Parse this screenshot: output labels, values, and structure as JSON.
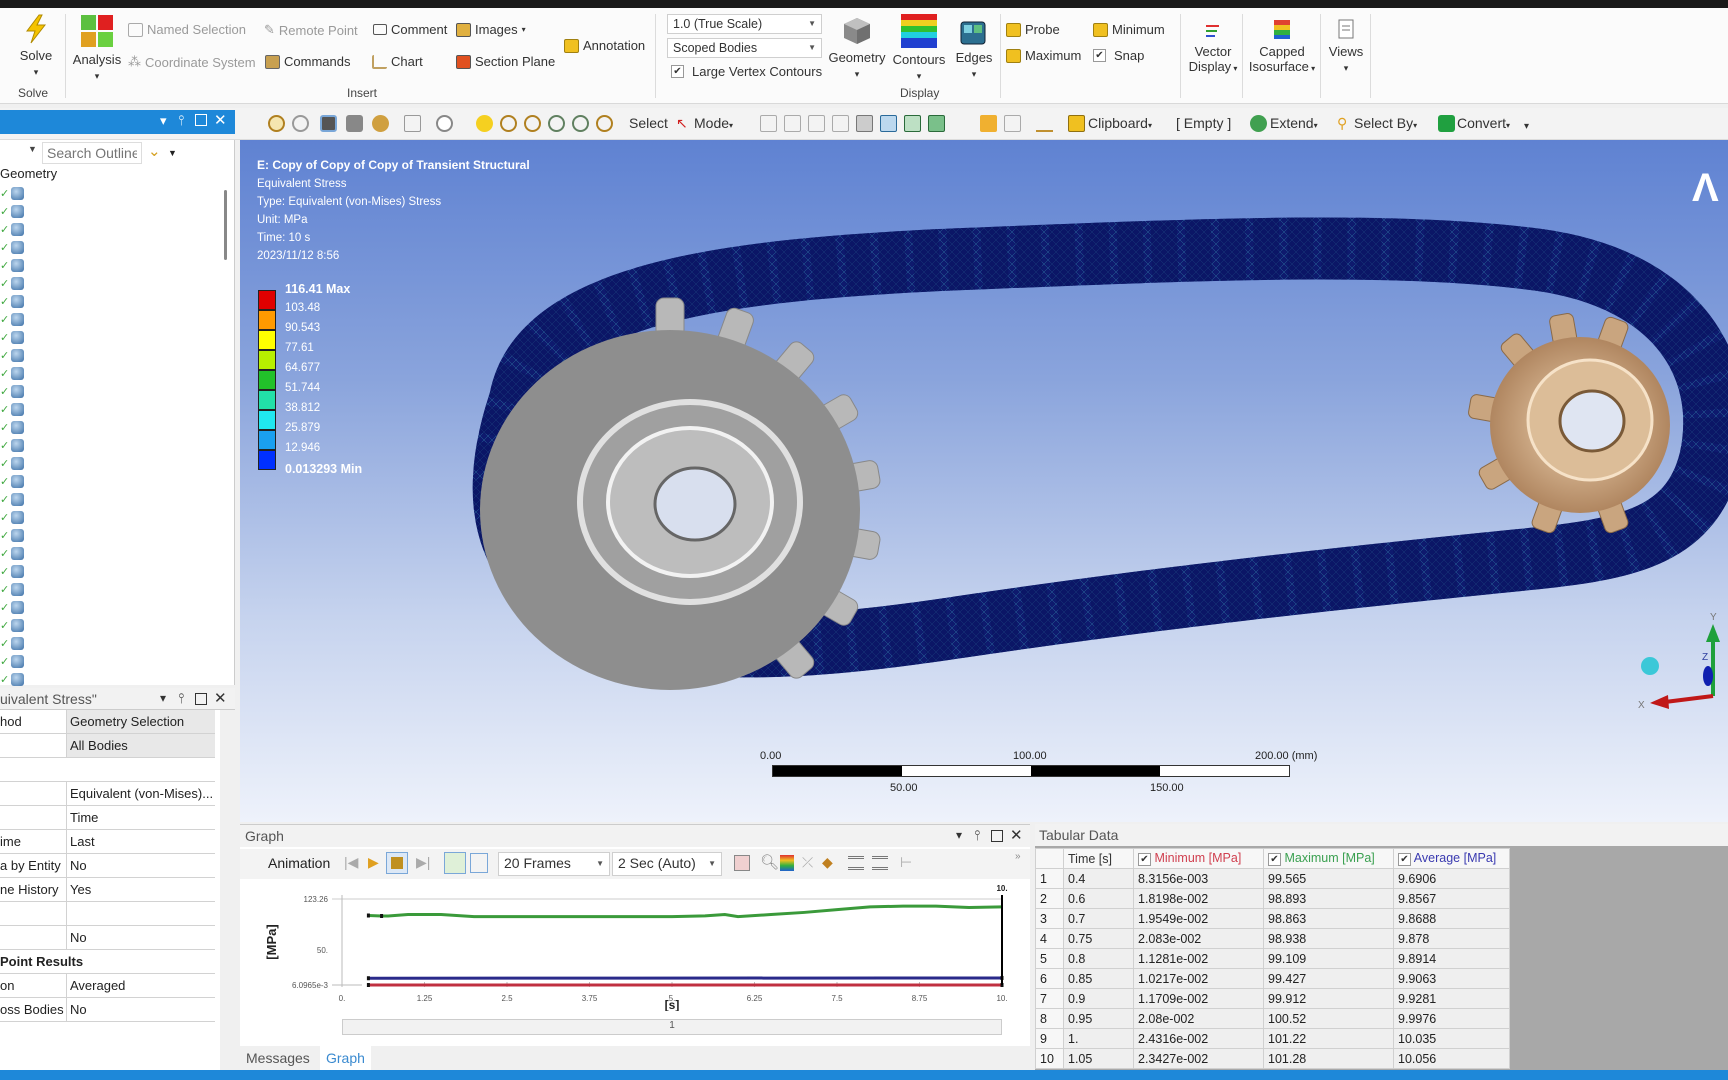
{
  "ribbon": {
    "solve": {
      "label": "Solve",
      "group": "Solve"
    },
    "analysis": {
      "label": "Analysis"
    },
    "insert": {
      "group": "Insert",
      "named_selection": "Named Selection",
      "remote_point": "Remote Point",
      "comment": "Comment",
      "images": "Images",
      "coordinate_system": "Coordinate System",
      "commands": "Commands",
      "chart": "Chart",
      "section_plane": "Section Plane",
      "annotation": "Annotation"
    },
    "display": {
      "group": "Display",
      "scale_value": "1.0 (True Scale)",
      "scope_value": "Scoped Bodies",
      "large_vertex_label": "Large Vertex Contours",
      "large_vertex_checked": true,
      "geometry": "Geometry",
      "contours": "Contours",
      "edges": "Edges",
      "probe": "Probe",
      "minimum": "Minimum",
      "maximum": "Maximum",
      "snap": "Snap",
      "snap_checked": true,
      "vector_display": "Vector Display",
      "capped_isosurface": "Capped Isosurface",
      "views": "Views"
    }
  },
  "toolbar": {
    "select": "Select",
    "mode": "Mode",
    "clipboard": "Clipboard",
    "clipboard_state": "[ Empty ]",
    "extend": "Extend",
    "select_by": "Select By",
    "convert": "Convert"
  },
  "outline": {
    "search_placeholder": "Search Outline",
    "root": "Geometry",
    "body_count": 28
  },
  "details": {
    "title": "uivalent Stress\"",
    "rows": [
      {
        "key": "hod",
        "value": "Geometry Selection",
        "shade": true
      },
      {
        "key": "",
        "value": "All Bodies",
        "shade": true
      },
      {
        "key": "",
        "value": "",
        "blank": true
      },
      {
        "key": "",
        "value": "Equivalent (von-Mises)..."
      },
      {
        "key": "",
        "value": "Time"
      },
      {
        "key": "ime",
        "value": "Last"
      },
      {
        "key": "a by Entity",
        "value": "No"
      },
      {
        "key": "ne History",
        "value": "Yes"
      },
      {
        "key": "",
        "value": ""
      },
      {
        "key": "",
        "value": "No"
      },
      {
        "section": "Point Results"
      },
      {
        "key": "on",
        "value": "Averaged"
      },
      {
        "key": "oss Bodies",
        "value": "No"
      }
    ]
  },
  "viewport": {
    "title": "E: Copy of Copy of Copy of Transient Structural",
    "result_name": "Equivalent Stress",
    "type": "Type: Equivalent (von-Mises) Stress",
    "unit": "Unit: MPa",
    "time": "Time: 10 s",
    "date": "2023/11/12 8:56",
    "legend": {
      "values": [
        "116.41 Max",
        "103.48",
        "90.543",
        "77.61",
        "64.677",
        "51.744",
        "38.812",
        "25.879",
        "12.946",
        "0.013293 Min"
      ],
      "colors": [
        "#e00000",
        "#ff9a00",
        "#ffff00",
        "#b8f000",
        "#22c22a",
        "#22e0a8",
        "#20e8f0",
        "#1aa0f0",
        "#0030ff"
      ]
    },
    "scale_bar": {
      "labels_top": [
        "0.00",
        "100.00",
        "200.00 (mm)"
      ],
      "labels_bottom": [
        "50.00",
        "150.00"
      ]
    },
    "triad": {
      "x": "X",
      "y": "Y",
      "z": "Z"
    }
  },
  "graph": {
    "title": "Graph",
    "animation_label": "Animation",
    "frames": "20 Frames",
    "duration": "2 Sec (Auto)",
    "scrub_value": "1",
    "chart_data": {
      "type": "line",
      "title": "",
      "xlabel": "[s]",
      "ylabel": "[MPa]",
      "x_ticks": [
        "0.",
        "1.25",
        "2.5",
        "3.75",
        "5.",
        "6.25",
        "7.5",
        "8.75",
        "10."
      ],
      "y_ticks": [
        "6.0965e-3",
        "50.",
        "123.26"
      ],
      "xlim": [
        0,
        10
      ],
      "ylim": [
        0.0060965,
        123.26
      ],
      "current_time_label": "10.",
      "series": [
        {
          "name": "Maximum",
          "color": "#3a9a3a",
          "x": [
            0.4,
            0.6,
            0.7,
            1.0,
            1.5,
            2.0,
            3.0,
            4.0,
            5.0,
            5.5,
            5.8,
            6.0,
            6.5,
            7.0,
            7.5,
            8.0,
            8.5,
            9.0,
            9.5,
            10.0
          ],
          "values": [
            99.6,
            98.9,
            98.9,
            101,
            101,
            98,
            98,
            98,
            98,
            99,
            101,
            98,
            101,
            104,
            108,
            112,
            113,
            113,
            111,
            112
          ]
        },
        {
          "name": "Average",
          "color": "#2a2a8a",
          "x": [
            0.4,
            10.0
          ],
          "values": [
            9.7,
            10.1
          ]
        },
        {
          "name": "Minimum",
          "color": "#c03040",
          "x": [
            0.4,
            10.0
          ],
          "values": [
            0.0083,
            0.02
          ]
        }
      ]
    }
  },
  "tabular": {
    "title": "Tabular Data",
    "headers": [
      "Time [s]",
      "Minimum [MPa]",
      "Maximum [MPa]",
      "Average [MPa]"
    ],
    "header_colors": [
      "#333333",
      "#d04050",
      "#3aa050",
      "#3a3ab0"
    ],
    "rows": [
      [
        "1",
        "0.4",
        "8.3156e-003",
        "99.565",
        "9.6906"
      ],
      [
        "2",
        "0.6",
        "1.8198e-002",
        "98.893",
        "9.8567"
      ],
      [
        "3",
        "0.7",
        "1.9549e-002",
        "98.863",
        "9.8688"
      ],
      [
        "4",
        "0.75",
        "2.083e-002",
        "98.938",
        "9.878"
      ],
      [
        "5",
        "0.8",
        "1.1281e-002",
        "99.109",
        "9.8914"
      ],
      [
        "6",
        "0.85",
        "1.0217e-002",
        "99.427",
        "9.9063"
      ],
      [
        "7",
        "0.9",
        "1.1709e-002",
        "99.912",
        "9.9281"
      ],
      [
        "8",
        "0.95",
        "2.08e-002",
        "100.52",
        "9.9976"
      ],
      [
        "9",
        "1.",
        "2.4316e-002",
        "101.22",
        "10.035"
      ],
      [
        "10",
        "1.05",
        "2.3427e-002",
        "101.28",
        "10.056"
      ]
    ]
  },
  "bottom_tabs": {
    "messages": "Messages",
    "graph": "Graph"
  }
}
